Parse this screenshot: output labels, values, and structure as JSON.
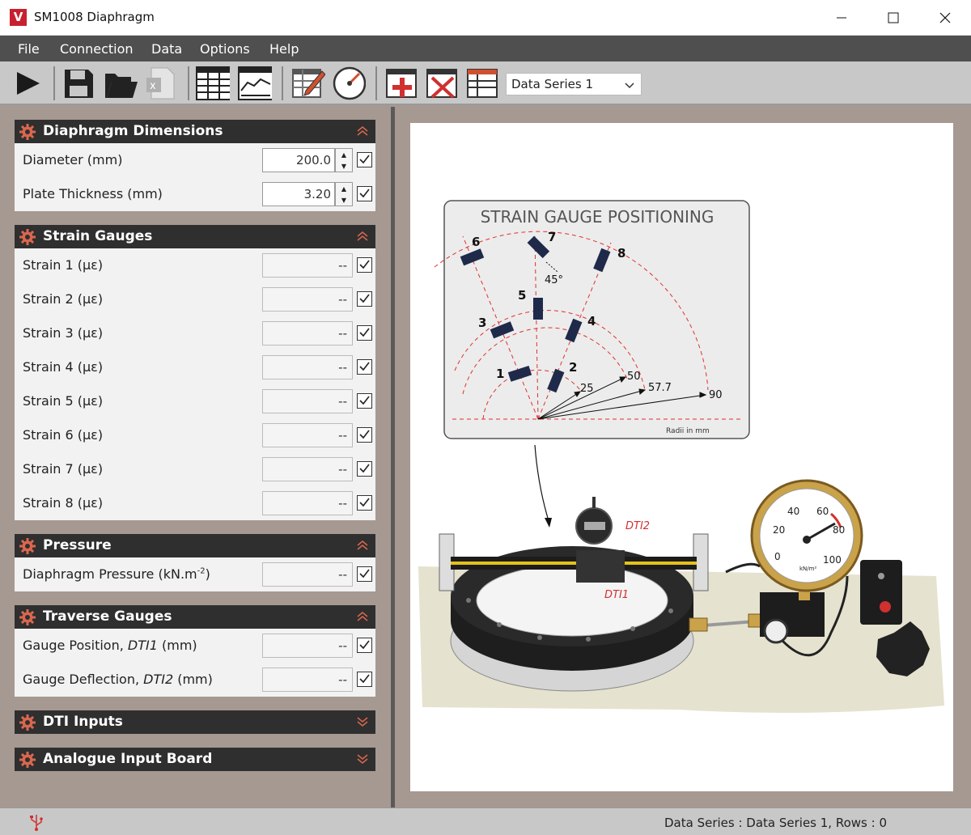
{
  "window": {
    "title": "SM1008 Diaphragm",
    "logo": "V"
  },
  "menu": [
    "File",
    "Connection",
    "Data",
    "Options",
    "Help"
  ],
  "toolbar": {
    "series_selected": "Data Series 1"
  },
  "panels": {
    "dims": {
      "title": "Diaphragm Dimensions",
      "diameter_label": "Diameter  (mm)",
      "diameter_value": "200.0",
      "thickness_label": "Plate Thickness  (mm)",
      "thickness_value": "3.20"
    },
    "strain": {
      "title": "Strain Gauges",
      "items": [
        {
          "label": "Strain 1  (με)",
          "value": "--"
        },
        {
          "label": "Strain 2  (με)",
          "value": "--"
        },
        {
          "label": "Strain 3  (με)",
          "value": "--"
        },
        {
          "label": "Strain 4  (με)",
          "value": "--"
        },
        {
          "label": "Strain 5  (με)",
          "value": "--"
        },
        {
          "label": "Strain 6  (με)",
          "value": "--"
        },
        {
          "label": "Strain 7  (με)",
          "value": "--"
        },
        {
          "label": "Strain 8  (με)",
          "value": "--"
        }
      ]
    },
    "pressure": {
      "title": "Pressure",
      "label_main": "Diaphragm Pressure  (kN.m",
      "label_sup": "-2",
      "label_end": ")",
      "value": "--"
    },
    "traverse": {
      "title": "Traverse Gauges",
      "pos_label": "Gauge Position, ",
      "pos_italic": "DTI1",
      "pos_unit": "  (mm)",
      "pos_value": "--",
      "def_label": "Gauge Deflection, ",
      "def_italic": "DTI2",
      "def_unit": "  (mm)",
      "def_value": "--"
    },
    "dti": {
      "title": "DTI Inputs"
    },
    "analogue": {
      "title": "Analogue Input Board"
    }
  },
  "diagram": {
    "title": "STRAIN GAUGE POSITIONING",
    "gauges": [
      "1",
      "2",
      "3",
      "4",
      "5",
      "6",
      "7",
      "8"
    ],
    "angle": "45°",
    "radii": [
      "25",
      "50",
      "57.7",
      "90"
    ],
    "radii_note": "Radii in mm",
    "dti1": "DTI1",
    "dti2": "DTI2",
    "gauge_ticks": [
      "0",
      "20",
      "40",
      "60",
      "80",
      "100"
    ],
    "gauge_unit": "kN/m²"
  },
  "status": {
    "text": "Data Series : Data Series 1,  Rows : 0"
  },
  "colors": {
    "accent": "#c8202f",
    "panel_head": "#2f2f2f",
    "gauge_marker": "#1f2a4a",
    "dashed": "#e03030"
  }
}
